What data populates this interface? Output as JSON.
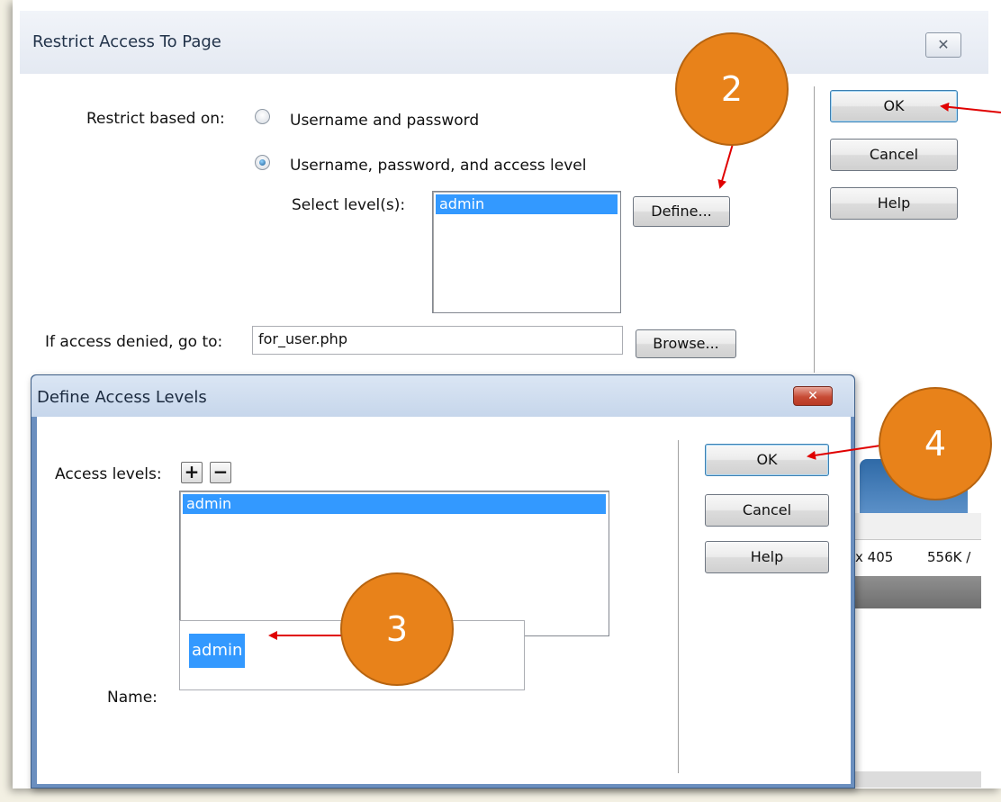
{
  "restrict_dialog": {
    "title": "Restrict Access To Page",
    "close_glyph": "✕",
    "restrict_based_on_label": "Restrict based on:",
    "option_username_password": "Username and password",
    "option_username_password_level": "Username, password, and access level",
    "selected_option": "Username, password, and access level",
    "select_levels_label": "Select level(s):",
    "levels": [
      "admin"
    ],
    "define_button": "Define...",
    "if_denied_label": "If access denied, go to:",
    "if_denied_value": "for_user.php",
    "browse_button": "Browse...",
    "ok_button": "OK",
    "cancel_button": "Cancel",
    "help_button": "Help"
  },
  "background_app": {
    "status_dims": "x 405",
    "status_size": "556K /"
  },
  "define_dialog": {
    "title": "Define Access Levels",
    "close_glyph": "✕",
    "access_levels_label": "Access levels:",
    "add_glyph": "+",
    "remove_glyph": "−",
    "access_levels": [
      "admin"
    ],
    "name_label": "Name:",
    "name_value": "admin",
    "ok_button": "OK",
    "cancel_button": "Cancel",
    "help_button": "Help"
  },
  "annotations": {
    "step_2": "2",
    "step_3": "3",
    "step_4": "4",
    "color": "#e8821a",
    "arrow_color": "#e00000"
  }
}
